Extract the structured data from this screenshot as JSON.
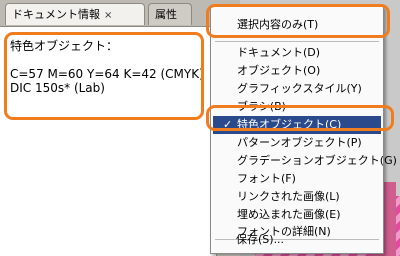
{
  "tabs": [
    {
      "label": "ドキュメント情報",
      "close": "×"
    },
    {
      "label": "属性"
    }
  ],
  "info": {
    "lines": [
      "特色オブジェクト：",
      "C=57 M=60 Y=64 K=42 (CMYK)",
      "DIC 150s* (Lab)"
    ]
  },
  "menu": {
    "top_item": "選択内容のみ(T)",
    "items": [
      "ドキュメント(D)",
      "オブジェクト(O)",
      "グラフィックスタイル(Y)",
      "ブラシ(B)",
      "特色オブジェクト(C)",
      "パターンオブジェクト(P)",
      "グラデーションオブジェクト(G)",
      "フォント(F)",
      "リンクされた画像(L)",
      "埋め込まれた画像(E)",
      "フォントの詳細(N)"
    ],
    "selected_check": "✓",
    "save_item": "保存(S)..."
  },
  "colors": {
    "highlight": "#ef7d1f",
    "selection": "#2b4a8c"
  }
}
